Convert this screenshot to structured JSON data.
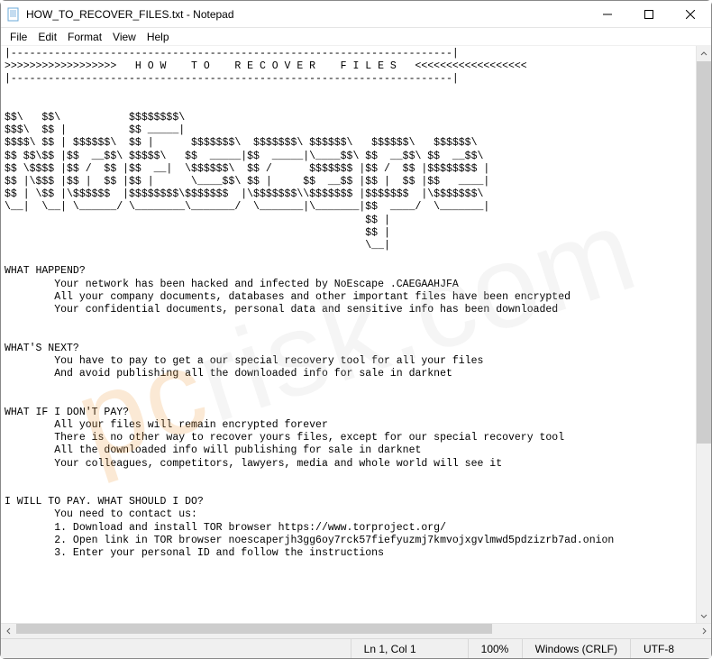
{
  "window": {
    "title": "HOW_TO_RECOVER_FILES.txt - Notepad"
  },
  "menu": {
    "file": "File",
    "edit": "Edit",
    "format": "Format",
    "view": "View",
    "help": "Help"
  },
  "statusbar": {
    "position": "Ln 1, Col 1",
    "zoom": "100%",
    "line_ending": "Windows (CRLF)",
    "encoding": "UTF-8"
  },
  "watermark": {
    "prefix": "pc",
    "suffix": "risk.com"
  },
  "document_lines": [
    "|-----------------------------------------------------------------------|",
    ">>>>>>>>>>>>>>>>>>   H O W    T O    R E C O V E R    F I L E S   <<<<<<<<<<<<<<<<<<",
    "|-----------------------------------------------------------------------|",
    "",
    "",
    "$$\\   $$\\           $$$$$$$$\\",
    "$$$\\  $$ |          $$ _____|",
    "$$$$\\ $$ | $$$$$$\\  $$ |      $$$$$$$\\  $$$$$$$\\ $$$$$$\\   $$$$$$\\   $$$$$$\\",
    "$$ $$\\$$ |$$  __$$\\ $$$$$\\   $$  _____|$$  _____|\\____$$\\ $$  __$$\\ $$  __$$\\",
    "$$ \\$$$$ |$$ /  $$ |$$  __|  \\$$$$$$\\  $$ /      $$$$$$$ |$$ /  $$ |$$$$$$$$ |",
    "$$ |\\$$$ |$$ |  $$ |$$ |      \\____$$\\ $$ |     $$  __$$ |$$ |  $$ |$$   ____|",
    "$$ | \\$$ |\\$$$$$$  |$$$$$$$$\\$$$$$$$  |\\$$$$$$$\\\\$$$$$$$ |$$$$$$$  |\\$$$$$$$\\",
    "\\__|  \\__| \\______/ \\________\\_______/  \\_______|\\_______|$$  ____/  \\_______|",
    "                                                          $$ |",
    "                                                          $$ |",
    "                                                          \\__|",
    "",
    "WHAT HAPPEND?",
    "        Your network has been hacked and infected by NoEscape .CAEGAAHJFA",
    "        All your company documents, databases and other important files have been encrypted",
    "        Your confidential documents, personal data and sensitive info has been downloaded",
    "",
    "",
    "WHAT'S NEXT?",
    "        You have to pay to get a our special recovery tool for all your files",
    "        And avoid publishing all the downloaded info for sale in darknet",
    "",
    "",
    "WHAT IF I DON'T PAY?",
    "        All your files will remain encrypted forever",
    "        There is no other way to recover yours files, except for our special recovery tool",
    "        All the downloaded info will publishing for sale in darknet",
    "        Your colleagues, competitors, lawyers, media and whole world will see it",
    "",
    "",
    "I WILL TO PAY. WHAT SHOULD I DO?",
    "        You need to contact us:",
    "        1. Download and install TOR browser https://www.torproject.org/",
    "        2. Open link in TOR browser noescaperjh3gg6oy7rck57fiefyuzmj7kmvojxgvlmwd5pdzizrb7ad.onion",
    "        3. Enter your personal ID and follow the instructions"
  ]
}
